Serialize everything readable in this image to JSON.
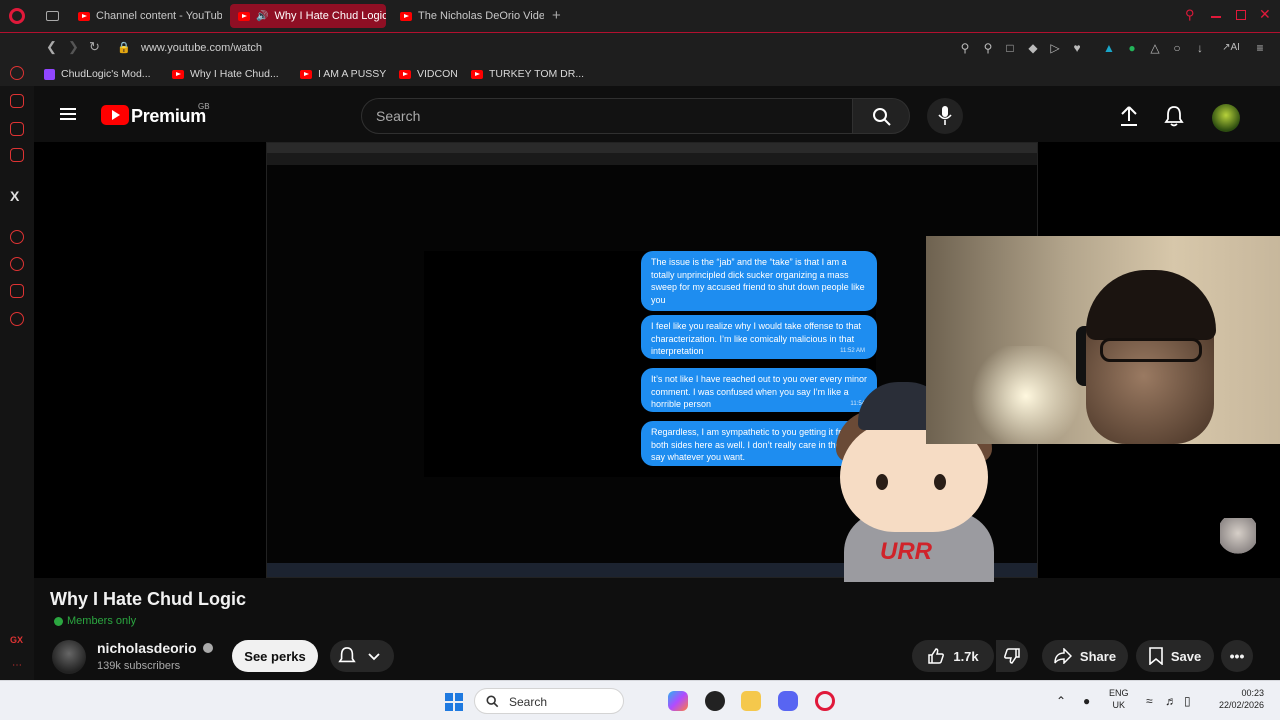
{
  "browser": {
    "tabs": [
      {
        "label": "Channel content - YouTube",
        "active": false
      },
      {
        "label": "Why I Hate Chud Logic",
        "active": true
      },
      {
        "label": "The Nicholas DeOrio Video",
        "active": false
      }
    ],
    "url": "www.youtube.com/watch",
    "bookmarks": [
      "ChudLogic's Mod...",
      "Why I Hate Chud...",
      "I AM A PUSSY",
      "VIDCON",
      "TURKEY TOM DR..."
    ],
    "sidebar_bottom": "GX"
  },
  "youtube": {
    "logo_text": "Premium",
    "region": "GB",
    "search_placeholder": "Search"
  },
  "video_content": {
    "bubbles": [
      {
        "text": "The issue is the “jab” and the “take” is that I am a totally unprincipled dick sucker organizing a mass sweep for my accused friend to shut down people like you",
        "time": ""
      },
      {
        "text": "I feel like you realize why I would take offense to that characterization. I’m like comically malicious in that interpretation",
        "time": "11:52 AM"
      },
      {
        "text": "It’s not like I have reached out to you over every minor comment. I was confused when you say I’m like a horrible person",
        "time": "11:54"
      },
      {
        "text": "Regardless, I am sympathetic to you getting it from both sides here as well. I don’t really care in the future say whatever you want.",
        "time": ""
      }
    ],
    "mascot_text": "URR"
  },
  "video": {
    "title": "Why I Hate Chud Logic",
    "badge": "Members only",
    "channel": "nicholasdeorio",
    "subscribers": "139k subscribers",
    "perks_label": "See perks",
    "likes": "1.7k",
    "share_label": "Share",
    "save_label": "Save"
  },
  "taskbar": {
    "search_label": "Search",
    "lang_line1": "ENG",
    "lang_line2": "UK",
    "time": "00:23",
    "date": "22/02/2026"
  },
  "colors": {
    "accent": "#b2102f",
    "youtube_red": "#ff0000",
    "chat_bubble": "#1e8df0",
    "members_green": "#2ba640"
  }
}
